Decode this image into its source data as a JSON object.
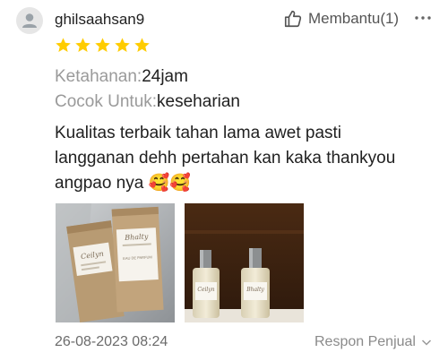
{
  "review": {
    "username": "ghilsaahsan9",
    "helpful_label": "Membantu(1)",
    "rating": 5,
    "rating_max": 5,
    "attributes": [
      {
        "label": "Ketahanan:",
        "value": "24jam"
      },
      {
        "label": "Cocok Untuk:",
        "value": "keseharian"
      }
    ],
    "text": "Kualitas terbaik tahan lama awet pasti langganan dehh pertahan kan kaka thankyou angpao nya 🥰🥰",
    "photos": [
      {
        "box_left": "Ceilyn",
        "box_right": "Bhalty",
        "box_sub": "EAU DE PARFUM"
      },
      {
        "bottle_left": "Ceilyn",
        "bottle_right": "Bhalty"
      }
    ],
    "date": "26-08-2023 08:24",
    "reply_label": "Respon Penjual"
  },
  "colors": {
    "star": "#ffcc00",
    "text": "#212121",
    "muted": "#9a9a9a"
  },
  "icons": {
    "avatar": "user-icon",
    "helpful": "thumbs-up-icon",
    "more": "more-dots-icon",
    "reply": "chevron-down-icon"
  }
}
